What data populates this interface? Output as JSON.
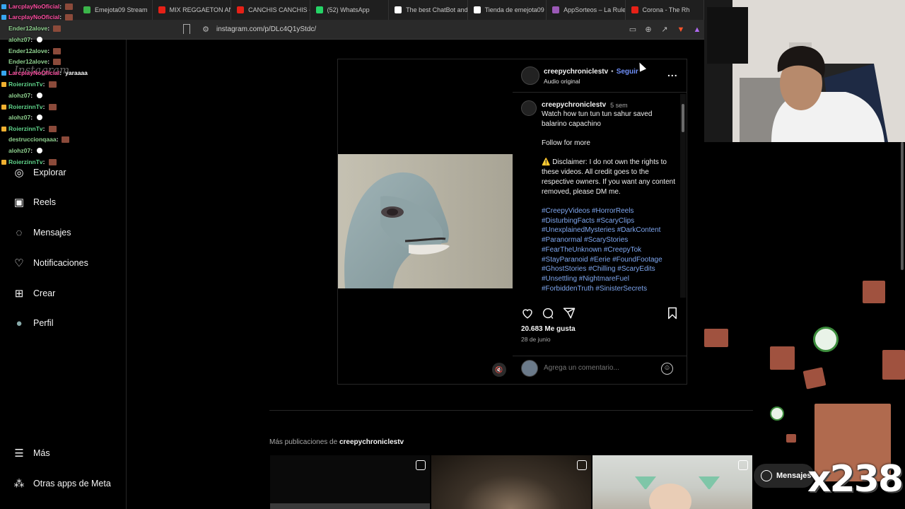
{
  "browser": {
    "tabs": [
      {
        "label": "Emejota09 Stream",
        "color": "#3bb54a"
      },
      {
        "label": "MIX REGGAETON ANT",
        "color": "#e62117"
      },
      {
        "label": "CANCHIS CANCHIS - Y",
        "color": "#e62117"
      },
      {
        "label": "(52) WhatsApp",
        "color": "#25d366"
      },
      {
        "label": "The best ChatBot and",
        "color": "#ffffff"
      },
      {
        "label": "Tienda de emejota09 |",
        "color": "#ffffff"
      },
      {
        "label": "AppSorteos – La Ruleta",
        "color": "#9b59b6"
      },
      {
        "label": "Corona - The Rh",
        "color": "#e62117"
      }
    ],
    "url": "instagram.com/p/DLc4Q1yStdc/"
  },
  "sidebar": {
    "logo": "Instagram",
    "items": [
      {
        "label": "Explorar",
        "icon": "compass-icon"
      },
      {
        "label": "Reels",
        "icon": "reels-icon"
      },
      {
        "label": "Mensajes",
        "icon": "messenger-icon"
      },
      {
        "label": "Notificaciones",
        "icon": "heart-icon"
      },
      {
        "label": "Crear",
        "icon": "plus-square-icon"
      },
      {
        "label": "Perfil",
        "icon": "avatar"
      }
    ],
    "more": "Más",
    "meta_apps": "Otras apps de Meta"
  },
  "post": {
    "username": "creepychroniclestv",
    "follow": "Seguir",
    "separator": "•",
    "audio": "Audio original",
    "caption_user": "creepychroniclestv",
    "caption_time": "5 sem",
    "caption_line1": "Watch how tun tun tun sahur saved balarino capachino",
    "caption_line2": "Follow for more",
    "caption_line3": "⚠️ Disclaimer: I do not own the rights to these videos. All credit goes to the respective owners. If you want any content removed, please DM me.",
    "hashtags": "#CreepyVideos #HorrorReels #DisturbingFacts #ScaryClips #UnexplainedMysteries #DarkContent #Paranormal #ScaryStories #FearTheUnknown #CreepyTok #StayParanoid #Eerie #FoundFootage #GhostStories #Chilling #ScaryEdits #Unsettling #NightmareFuel #ForbiddenTruth #SinisterSecrets",
    "likes": "20.683 Me gusta",
    "date": "28 de junio",
    "comment_placeholder": "Agrega un comentario...",
    "more_dots": "..."
  },
  "more_posts": {
    "prefix": "Más publicaciones de",
    "user": "creepychroniclestv"
  },
  "chat": [
    {
      "user": "LarcplayNoOficial",
      "text": "",
      "color": "#ff4fa3",
      "emote": true
    },
    {
      "user": "LarcplayNoOficial",
      "text": "",
      "color": "#ff4fa3",
      "emote": true
    },
    {
      "user": "Ender12alove",
      "text": "",
      "color": "#8fd18f",
      "emote": true
    },
    {
      "user": "alohz07",
      "text": "",
      "color": "#8fd18f",
      "emote": false
    },
    {
      "user": "Ender12alove",
      "text": "",
      "color": "#8fd18f",
      "emote": true
    },
    {
      "user": "Ender12alove",
      "text": "",
      "color": "#8fd18f",
      "emote": true
    },
    {
      "user": "LarcplayNoOficial",
      "text": "yaraaaa",
      "color": "#ff4fa3",
      "emote": false
    },
    {
      "user": "RoierzinnTv",
      "text": "",
      "color": "#5fd38a",
      "emote": true
    },
    {
      "user": "alohz07",
      "text": "",
      "color": "#8fd18f",
      "emote": false
    },
    {
      "user": "RoierzinnTv",
      "text": "",
      "color": "#5fd38a",
      "emote": true
    },
    {
      "user": "alohz07",
      "text": "",
      "color": "#8fd18f",
      "emote": false
    },
    {
      "user": "RoierzinnTv",
      "text": "",
      "color": "#5fd38a",
      "emote": true
    },
    {
      "user": "destruccionqaaa",
      "text": "",
      "color": "#8fd18f",
      "emote": true
    },
    {
      "user": "alohz07",
      "text": "",
      "color": "#8fd18f",
      "emote": false
    },
    {
      "user": "RoierzinnTv",
      "text": "",
      "color": "#5fd38a",
      "emote": true
    }
  ],
  "overlay": {
    "messages_label": "Mensajes",
    "combo": "x238"
  }
}
